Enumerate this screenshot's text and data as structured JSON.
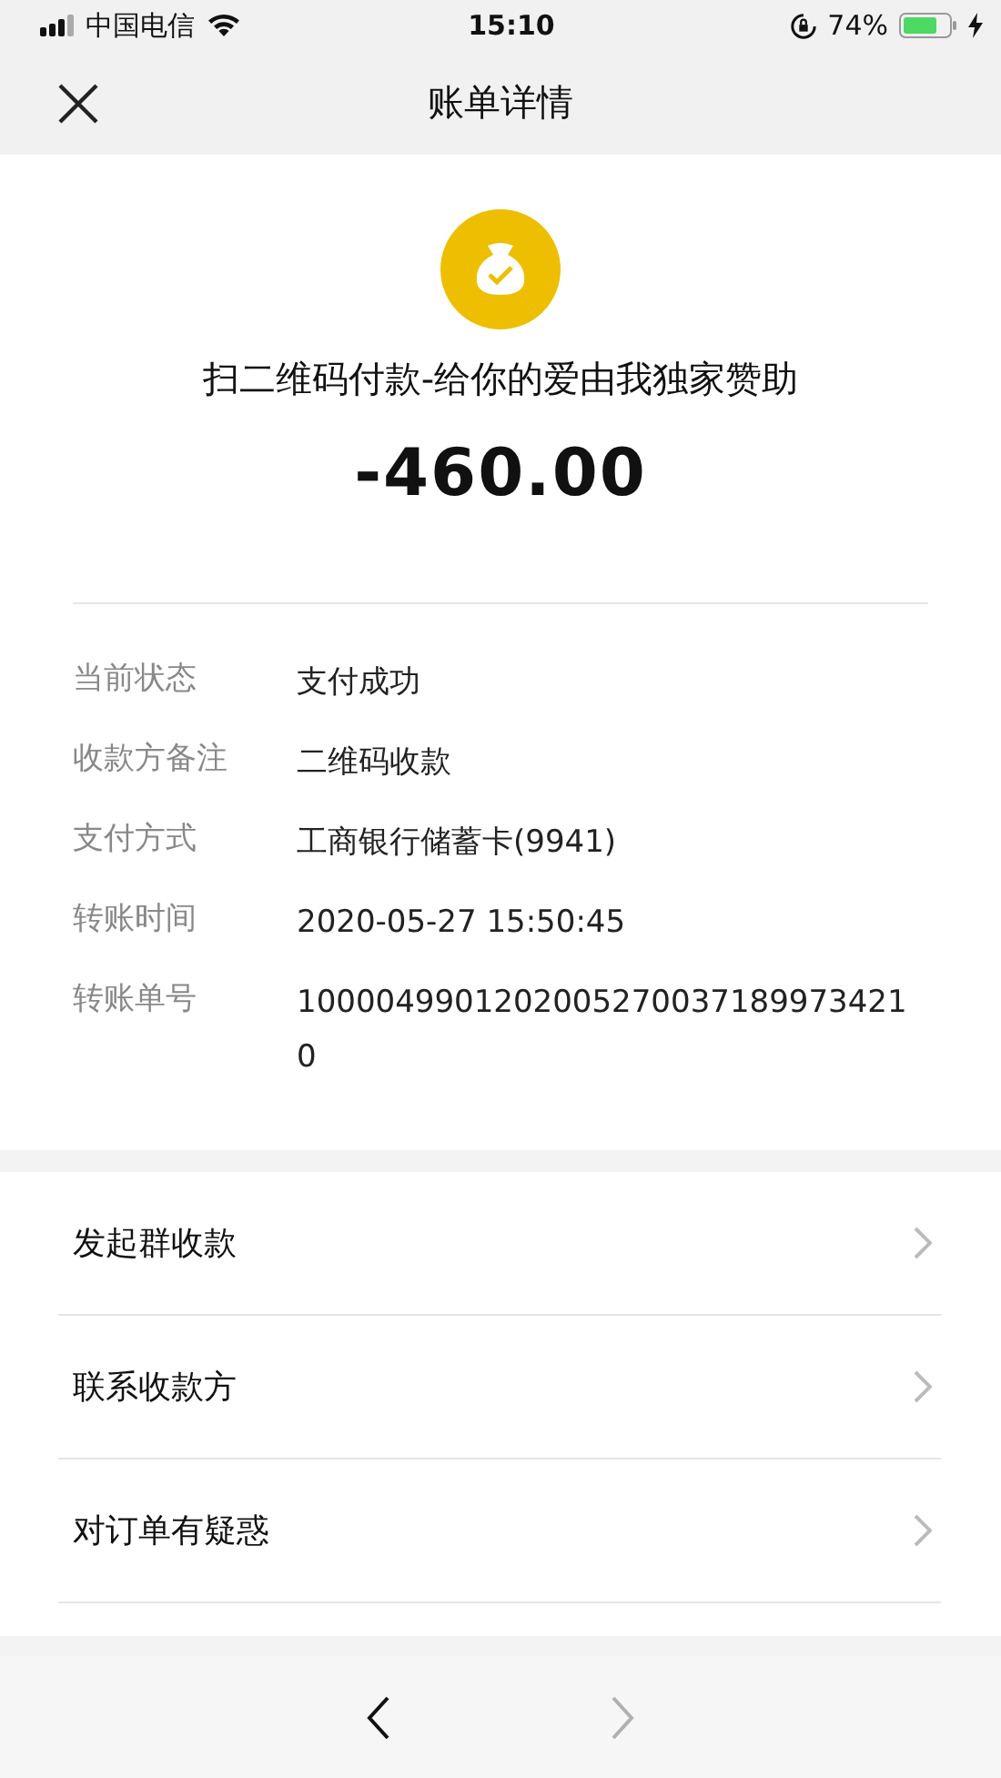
{
  "status_bar": {
    "carrier": "中国电信",
    "time": "15:10",
    "battery": "74%"
  },
  "header": {
    "title": "账单详情"
  },
  "summary": {
    "title": "扫二维码付款-给你的爱由我独家赞助",
    "amount": "-460.00"
  },
  "details": [
    {
      "label": "当前状态",
      "value": "支付成功"
    },
    {
      "label": "收款方备注",
      "value": "二维码收款"
    },
    {
      "label": "支付方式",
      "value": "工商银行储蓄卡(9941)"
    },
    {
      "label": "转账时间",
      "value": "2020-05-27 15:50:45"
    },
    {
      "label": "转账单号",
      "value": "10000499012020052700371899734210"
    }
  ],
  "actions": [
    "发起群收款",
    "联系收款方",
    "对订单有疑惑"
  ],
  "toolbar": {
    "back_disabled": false,
    "forward_disabled": true
  }
}
